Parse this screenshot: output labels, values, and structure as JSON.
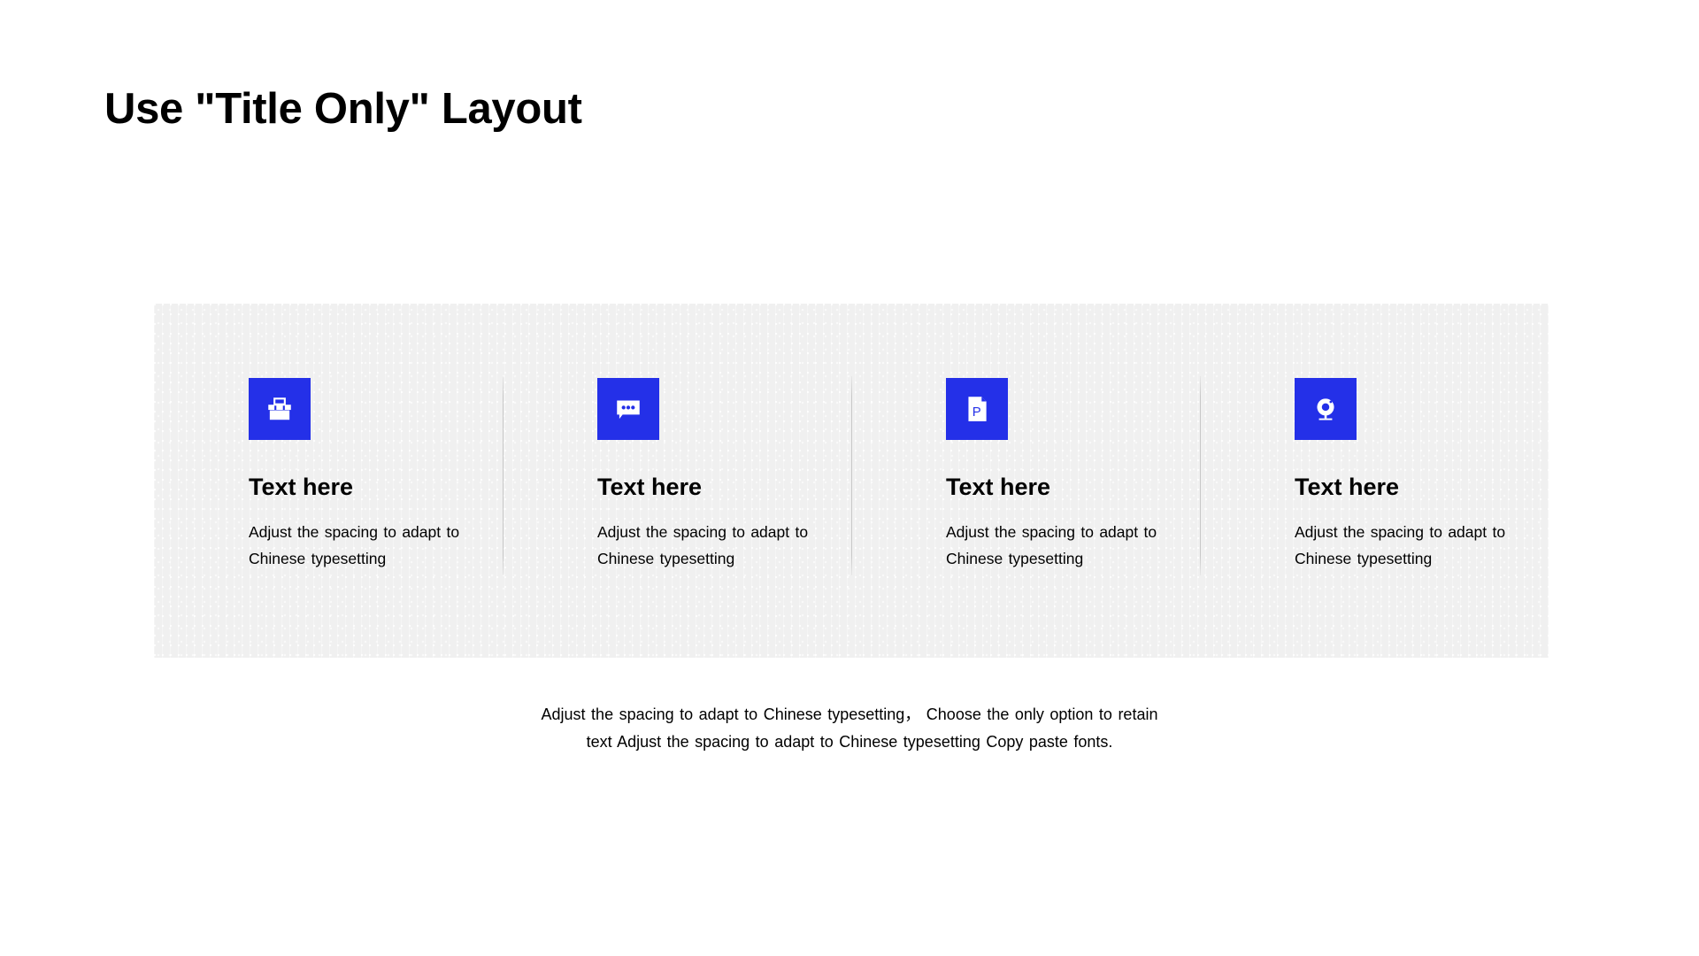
{
  "slide": {
    "title": "Use \"Title Only\" Layout",
    "accent_color": "#2430e8",
    "panel_color": "#f0f0f0",
    "text_color": "#000000"
  },
  "cards": [
    {
      "icon": "toolbox-icon",
      "heading": "Text here",
      "body": "Adjust the spacing to adapt to Chinese typesetting"
    },
    {
      "icon": "chat-bubble-icon",
      "heading": "Text here",
      "body": "Adjust the spacing to adapt to Chinese typesetting"
    },
    {
      "icon": "powerpoint-file-icon",
      "heading": "Text here",
      "body": "Adjust the spacing to adapt to Chinese typesetting"
    },
    {
      "icon": "webcam-icon",
      "heading": "Text here",
      "body": "Adjust the spacing to adapt to Chinese typesetting"
    }
  ],
  "footer": {
    "line1": "Adjust the spacing to adapt to Chinese typesetting， Choose the only option to retain",
    "line2": "text Adjust the spacing to adapt to Chinese typesetting Copy paste fonts."
  }
}
